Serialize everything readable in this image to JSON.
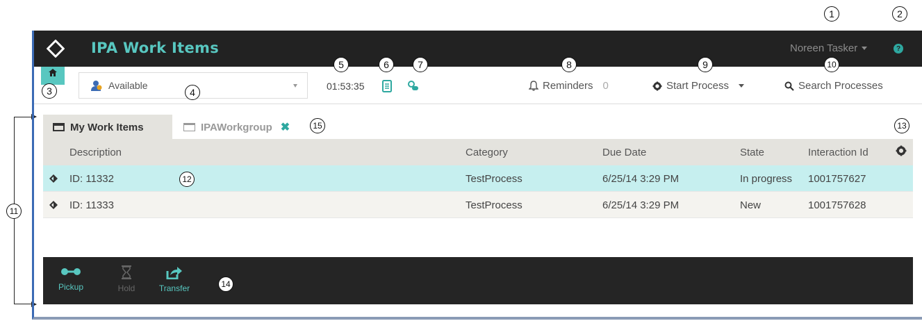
{
  "app": {
    "title": "IPA Work Items",
    "user": "Noreen Tasker",
    "help_icon": "question-icon",
    "accent_color": "#58c7c0"
  },
  "toolbar": {
    "home_icon": "home-icon",
    "status": "Available",
    "timer": "01:53:35",
    "reminders_label": "Reminders",
    "reminders_count": "0",
    "start_process_label": "Start Process",
    "search_label": "Search Processes"
  },
  "tabs": [
    {
      "label": "My Work Items",
      "active": true
    },
    {
      "label": "IPAWorkgroup",
      "active": false
    }
  ],
  "grid": {
    "columns": [
      "Description",
      "Category",
      "Due Date",
      "State",
      "Interaction Id"
    ],
    "rows": [
      {
        "description": "ID: 11332",
        "category": "TestProcess",
        "due_date": "6/25/14 3:29 PM",
        "state": "In progress",
        "interaction_id": "1001757627",
        "selected": true
      },
      {
        "description": "ID: 11333",
        "category": "TestProcess",
        "due_date": "6/25/14 3:29 PM",
        "state": "New",
        "interaction_id": "1001757628",
        "selected": false
      }
    ]
  },
  "actions": [
    {
      "label": "Pickup",
      "enabled": true
    },
    {
      "label": "Hold",
      "enabled": false
    },
    {
      "label": "Transfer",
      "enabled": true
    }
  ],
  "callouts": [
    "1",
    "2",
    "3",
    "4",
    "5",
    "6",
    "7",
    "8",
    "9",
    "10",
    "11",
    "12",
    "13",
    "14",
    "15"
  ]
}
